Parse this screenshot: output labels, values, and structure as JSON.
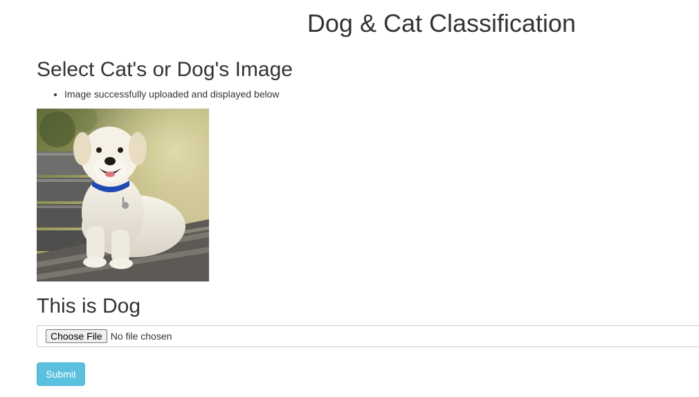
{
  "header": {
    "title": "Dog & Cat Classification"
  },
  "upload": {
    "heading": "Select Cat's or Dog's Image",
    "messages": [
      "Image successfully uploaded and displayed below"
    ]
  },
  "preview": {
    "image_subject": "white labrador dog lying on wooden bench"
  },
  "result": {
    "text": "This is Dog"
  },
  "file_input": {
    "button_label": "Choose File",
    "status_text": "No file chosen"
  },
  "submit": {
    "label": "Submit"
  },
  "colors": {
    "text": "#333333",
    "submit_bg": "#5bc0de",
    "submit_border": "#46b8da",
    "input_border": "#cccccc"
  }
}
